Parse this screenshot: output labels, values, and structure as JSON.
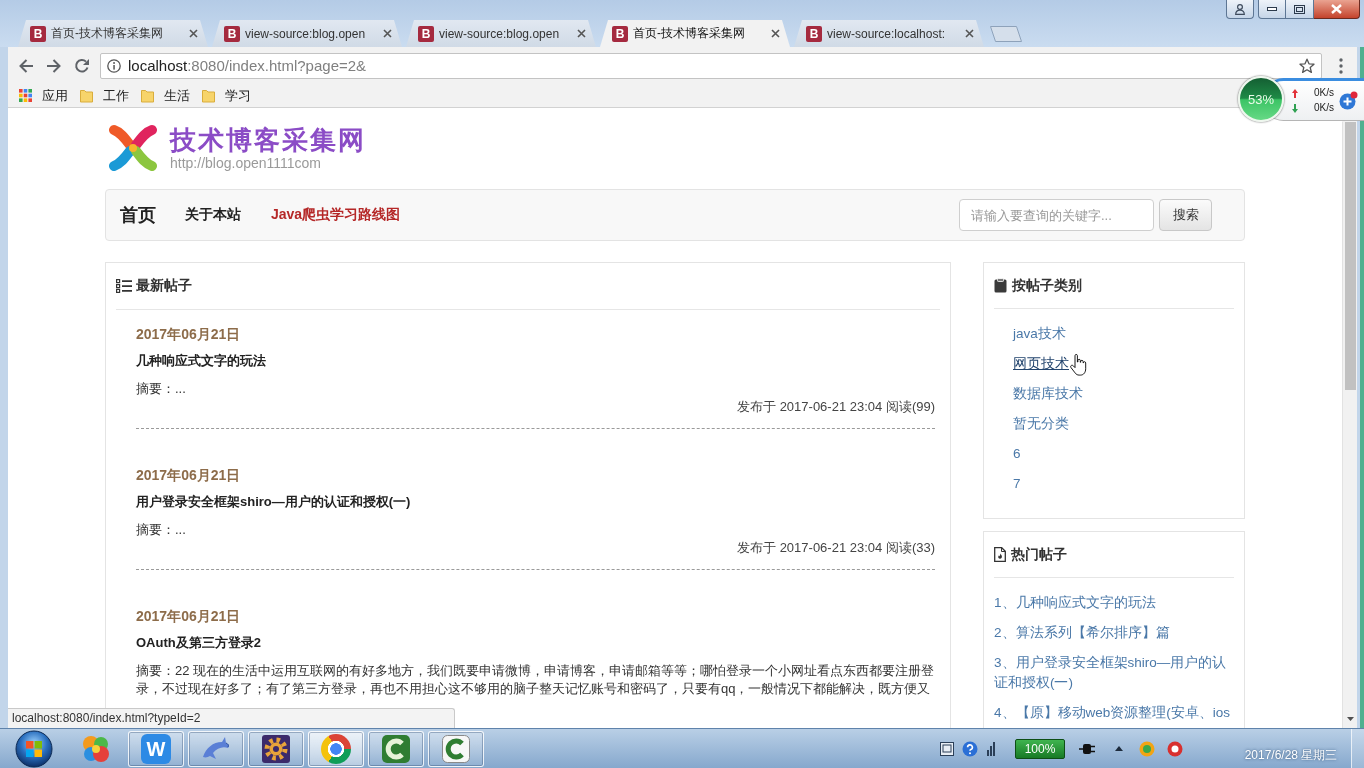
{
  "tabs": [
    {
      "favicon": "B",
      "title": "首页-技术博客采集网",
      "selected": false
    },
    {
      "favicon": "B",
      "title": "view-source:blog.open",
      "selected": false
    },
    {
      "favicon": "B",
      "title": "view-source:blog.open",
      "selected": false
    },
    {
      "favicon": "B",
      "title": "首页-技术博客采集网",
      "selected": true
    },
    {
      "favicon": "B",
      "title": "view-source:localhost:",
      "selected": false
    }
  ],
  "toolbar": {
    "url_host": "localhost",
    "url_rest": ":8080/index.html?page=2&"
  },
  "bookmarks": [
    {
      "kind": "apps",
      "label": "应用"
    },
    {
      "kind": "folder",
      "label": "工作"
    },
    {
      "kind": "folder",
      "label": "生活"
    },
    {
      "kind": "folder",
      "label": "学习"
    }
  ],
  "speed_widget": {
    "usage": "53%",
    "upload": "0K/s",
    "download": "0K/s"
  },
  "site": {
    "title": "技术博客采集网",
    "url": "http://blog.open1111com"
  },
  "nav": {
    "items": [
      {
        "kind": "brand",
        "label": "首页"
      },
      {
        "kind": "link",
        "label": "关于本站"
      },
      {
        "kind": "highlight",
        "label": "Java爬虫学习路线图"
      }
    ],
    "search": {
      "placeholder": "请输入要查询的关键字...",
      "button": "搜索"
    }
  },
  "latest_posts": {
    "title": "最新帖子",
    "posts": [
      {
        "date": "2017年06月21日",
        "title": "几种响应式文字的玩法",
        "summary": "摘要：...",
        "meta": "发布于 2017-06-21 23:04 阅读(99)"
      },
      {
        "date": "2017年06月21日",
        "title": "用户登录安全框架shiro—用户的认证和授权(一)",
        "summary": "摘要：...",
        "meta": "发布于 2017-06-21 23:04 阅读(33)"
      },
      {
        "date": "2017年06月21日",
        "title": "OAuth及第三方登录2",
        "summary": "摘要：22 现在的生活中运用互联网的有好多地方，我们既要申请微博，申请博客，申请邮箱等等；哪怕登录一个小网址看点东西都要注册登录，不过现在好多了；有了第三方登录，再也不用担心这不够用的脑子整天记忆账号和密码了，只要有qq，一般情况下都能解决，既方便又"
      }
    ]
  },
  "categories": {
    "title": "按帖子类别",
    "items": [
      {
        "label": "java技术",
        "hovered": false
      },
      {
        "label": "网页技术",
        "hovered": true
      },
      {
        "label": "数据库技术",
        "hovered": false
      },
      {
        "label": "暂无分类",
        "hovered": false
      },
      {
        "label": "6",
        "hovered": false
      },
      {
        "label": "7",
        "hovered": false
      }
    ]
  },
  "hot_posts": {
    "title": "热门帖子",
    "items": [
      "1、几种响应式文字的玩法",
      "2、算法系列【希尔排序】篇",
      "3、用户登录安全框架shiro—用户的认证和授权(一)",
      "4、【原】移动web资源整理(安卓、ios"
    ]
  },
  "status_bar": {
    "url": "localhost:8080/index.html?typeId=2"
  },
  "taskbar": {
    "apps": [
      {
        "kind": "balls",
        "running": false,
        "selected": false
      },
      {
        "kind": "letter",
        "letter": "W",
        "running": true,
        "selected": false
      },
      {
        "kind": "dolphin",
        "running": true,
        "selected": false
      },
      {
        "kind": "gear",
        "running": true,
        "selected": false
      },
      {
        "kind": "tricolor",
        "running": true,
        "selected": true
      },
      {
        "kind": "arc-dark",
        "running": true,
        "selected": false
      },
      {
        "kind": "arc-light",
        "running": true,
        "selected": false
      }
    ],
    "battery": "100%",
    "date": "2017/6/28 星期三"
  }
}
